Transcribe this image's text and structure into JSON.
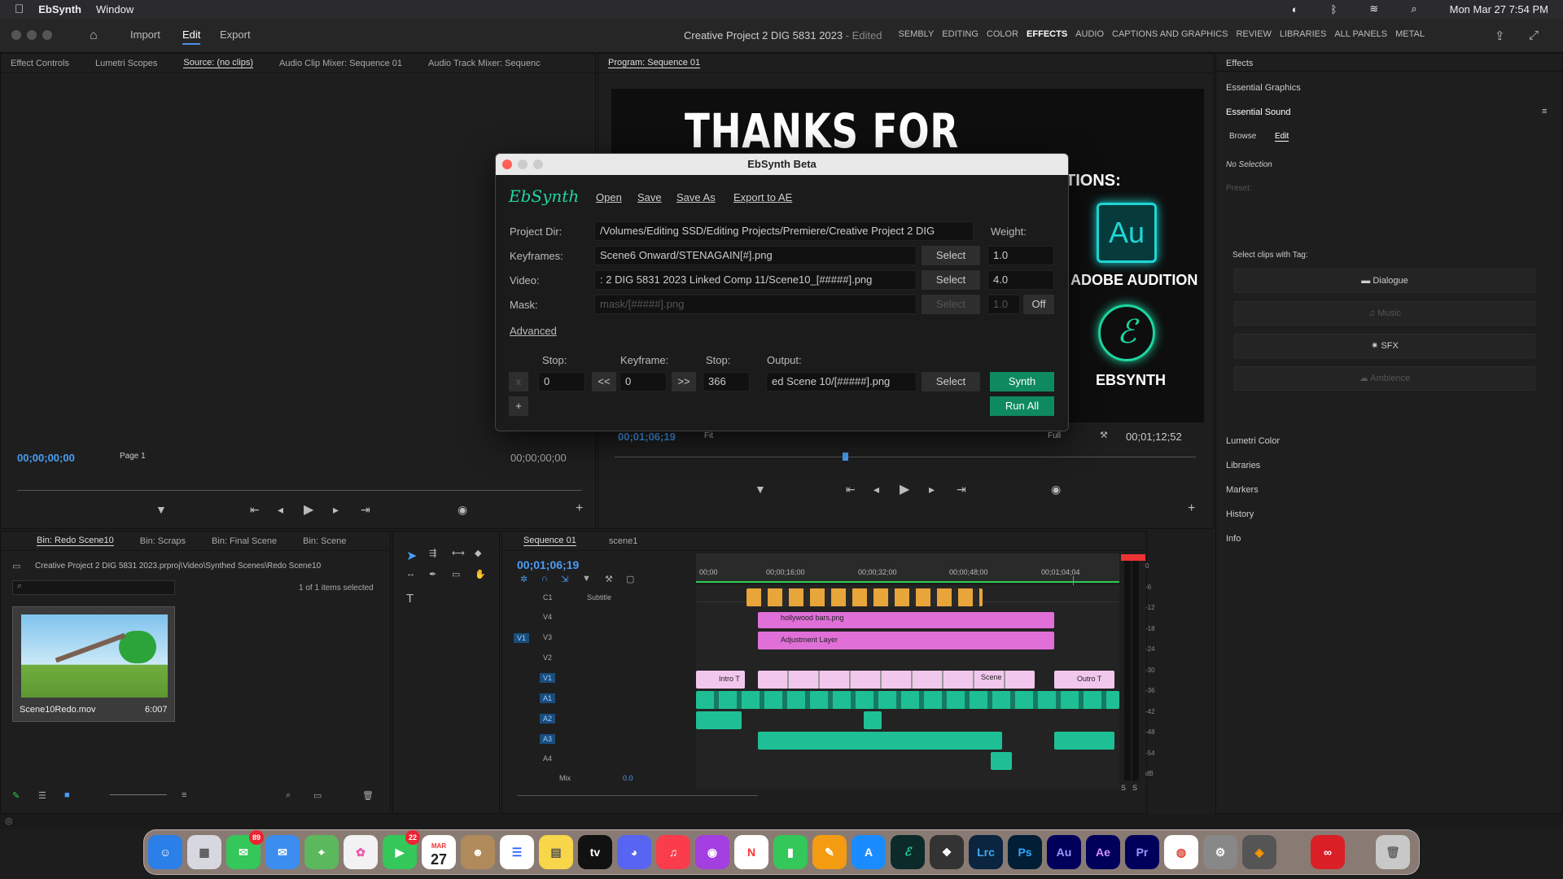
{
  "menubar": {
    "app": "EbSynth",
    "window": "Window",
    "datetime": "Mon Mar 27  7:54 PM"
  },
  "titlebar": {
    "nav": [
      "Import",
      "Edit",
      "Export"
    ],
    "active_nav": "Edit",
    "title": "Creative Project 2 DIG 5831 2023",
    "edited": " - Edited",
    "workspaces": [
      "SEMBLY",
      "EDITING",
      "COLOR",
      "EFFECTS",
      "AUDIO",
      "CAPTIONS AND GRAPHICS",
      "REVIEW",
      "LIBRARIES",
      "ALL PANELS",
      "METAL"
    ]
  },
  "source_panel": {
    "tabs": [
      "Effect Controls",
      "Lumetri Scopes",
      "Source: (no clips)",
      "Audio Clip Mixer: Sequence 01",
      "Audio Track Mixer: Sequenc"
    ],
    "tc_left": "00;00;00;00",
    "page": "Page 1",
    "tc_right": "00;00;00;00"
  },
  "program_panel": {
    "tab": "Program: Sequence 01",
    "video_title": "THANKS FOR WATCHING!",
    "video_sub": "TIONS:",
    "au_label": "Au",
    "au_caption": "ADOBE AUDITION",
    "eb_caption": "EBSYNTH",
    "tc_left": "00;01;06;19",
    "fit": "Fit",
    "quality": "Full",
    "tc_right": "00;01;12;52"
  },
  "right_panel": {
    "effects": "Effects",
    "essential_graphics": "Essential Graphics",
    "essential_sound": "Essential Sound",
    "tabs": [
      "Browse",
      "Edit"
    ],
    "no_selection": "No Selection",
    "preset": "Preset:",
    "select_tag": "Select clips with Tag:",
    "tags": [
      "Dialogue",
      "Music",
      "SFX",
      "Ambience"
    ],
    "others": [
      "Lumetri Color",
      "Libraries",
      "Markers",
      "History",
      "Info"
    ]
  },
  "bin_panel": {
    "tabs": [
      "Bin: Redo Scene10",
      "Bin: Scraps",
      "Bin: Final Scene",
      "Bin: Scene"
    ],
    "path": "Creative Project 2 DIG 5831 2023.prproj\\Video\\Synthed Scenes\\Redo Scene10",
    "selected": "1 of 1 items selected",
    "clip_name": "Scene10Redo.mov",
    "clip_duration": "6:007"
  },
  "timeline": {
    "tabs": [
      "Sequence 01",
      "scene1"
    ],
    "timecode": "00;01;06;19",
    "ruler": [
      "00;00",
      "00;00;16;00",
      "00;00;32;00",
      "00;00;48;00",
      "00;01;04;04"
    ],
    "tracks": [
      {
        "label": "C1",
        "name": "Subtitle"
      },
      {
        "label": "V4",
        "name": ""
      },
      {
        "label": "V3",
        "name": ""
      },
      {
        "label": "V2",
        "name": ""
      },
      {
        "label": "V1",
        "name": ""
      },
      {
        "label": "A1",
        "name": ""
      },
      {
        "label": "A2",
        "name": ""
      },
      {
        "label": "A3",
        "name": ""
      },
      {
        "label": "A4",
        "name": ""
      }
    ],
    "mix_label": "Mix",
    "mix_value": "0.0",
    "source_patch": "V1",
    "clip_v4": "hollywood bars.png",
    "clip_v3": "Adjustment Layer",
    "clip_intro": "Intro T",
    "clip_scene": "Scene",
    "clip_outro": "Outro T",
    "meter_scale": [
      "0",
      "-6",
      "-12",
      "-18",
      "-24",
      "-30",
      "-36",
      "-42",
      "-48",
      "-54",
      "dB"
    ],
    "meter_solo": [
      "S",
      "S"
    ]
  },
  "ebsynth": {
    "window_title": "EbSynth Beta",
    "logo": "EbSynth",
    "menu": [
      "Open",
      "Save",
      "Save As",
      "Export to AE"
    ],
    "project_dir_label": "Project Dir:",
    "project_dir": "/Volumes/Editing SSD/Editing Projects/Premiere/Creative Project 2 DIG",
    "weight_label": "Weight:",
    "keyframes_label": "Keyframes:",
    "keyframes": "Scene6 Onward/STENAGAIN[#].png",
    "keyframes_weight": "1.0",
    "video_label": "Video:",
    "video": ": 2 DIG 5831 2023 Linked Comp 11/Scene10_[#####].png",
    "video_weight": "4.0",
    "mask_label": "Mask:",
    "mask_placeholder": "mask/[#####].png",
    "mask_weight": "1.0",
    "mask_toggle": "Off",
    "select": "Select",
    "advanced": "Advanced",
    "col_stop1": "Stop:",
    "col_keyframe": "Keyframe:",
    "col_stop2": "Stop:",
    "col_output": "Output:",
    "row": {
      "x": "x",
      "stop1": "0",
      "prev": "<<",
      "keyframe": "0",
      "next": ">>",
      "stop2": "366",
      "output": "ed Scene 10/[#####].png"
    },
    "add": "+",
    "synth": "Synth",
    "run_all": "Run All"
  },
  "dock": {
    "apps": [
      "Finder",
      "Launchpad",
      "Messages",
      "Mail",
      "Maps",
      "Photos",
      "FaceTime",
      "Calendar",
      "Contacts",
      "Reminders",
      "Notes",
      "TV",
      "Discord",
      "Music",
      "Podcasts",
      "News",
      "Numbers",
      "Pages",
      "App Store",
      "EbSynth",
      "DaVinci",
      "Lrc",
      "Ps",
      "Au",
      "Ae",
      "Pr",
      "Chrome",
      "Settings",
      "Lens",
      "Creative Cloud",
      "Trash"
    ],
    "tv_label": "tv",
    "calendar_month": "MAR",
    "calendar_day": "27",
    "messages_badge": "89",
    "facetime_badge": "22"
  },
  "colors": {
    "accent": "#4a9df5",
    "synth_green": "#0f8a60",
    "clip_pink": "#e06fd8",
    "clip_orange": "#e8a53a",
    "audio_teal": "#1fbf95"
  }
}
